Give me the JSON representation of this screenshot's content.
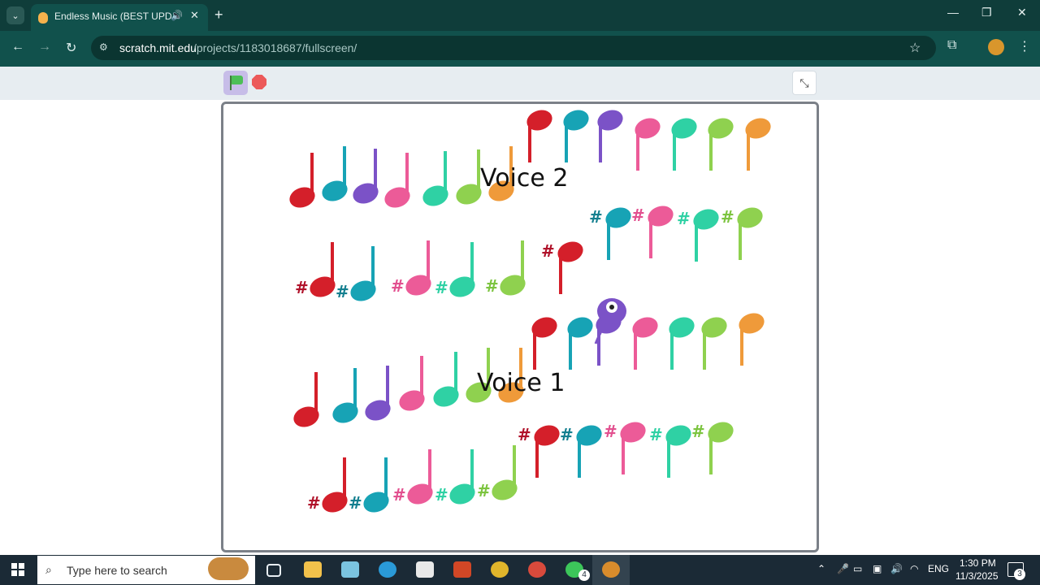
{
  "browser": {
    "tab_title": "Endless Music (BEST UPDATE)",
    "tab_close": "✕",
    "new_tab": "+",
    "window_min": "—",
    "window_max": "❐",
    "window_close": "✕",
    "url_host": "scratch.mit.edu",
    "url_path": "/projects/1183018687/fullscreen/",
    "icons": [
      "tab-search-icon",
      "audio-icon",
      "back-icon",
      "forward-icon",
      "reload-icon",
      "site-info-icon",
      "star-icon",
      "extensions-icon",
      "profile-avatar",
      "menu-icon"
    ]
  },
  "stage": {
    "voice2_label": "Voice 2",
    "voice1_label": "Voice 1",
    "sharp_symbol": "#",
    "note_colors": [
      "#d41f2a",
      "#17a3b5",
      "#7b52c7",
      "#ec5b98",
      "#2fd1a4",
      "#8fd14f",
      "#ef9a3a"
    ],
    "rows": [
      {
        "name": "voice2-naturals",
        "row": "voice-2",
        "kind": "natural",
        "notes": [
          "red",
          "teal",
          "purple",
          "pink",
          "mint",
          "green",
          "orange",
          "red",
          "teal",
          "purple",
          "pink",
          "mint",
          "green",
          "orange"
        ]
      },
      {
        "name": "voice2-sharps",
        "row": "voice-2",
        "kind": "sharp",
        "notes": [
          "red",
          "teal",
          "pink",
          "mint",
          "green",
          "red",
          "teal",
          "pink",
          "mint",
          "green"
        ]
      },
      {
        "name": "voice1-naturals",
        "row": "voice-1",
        "kind": "natural",
        "notes": [
          "red",
          "teal",
          "purple",
          "pink",
          "mint",
          "green",
          "orange",
          "red",
          "teal",
          "purple",
          "pink",
          "mint",
          "green",
          "orange"
        ]
      },
      {
        "name": "voice1-sharps",
        "row": "voice-1",
        "kind": "sharp",
        "notes": [
          "red",
          "teal",
          "pink",
          "mint",
          "green",
          "red",
          "teal",
          "pink",
          "mint",
          "green"
        ]
      }
    ]
  },
  "taskbar": {
    "search_placeholder": "Type here to search",
    "language": "ENG",
    "time": "1:30 PM",
    "date": "11/3/2025",
    "whatsapp_badge": "4",
    "notification_badge": "3"
  }
}
